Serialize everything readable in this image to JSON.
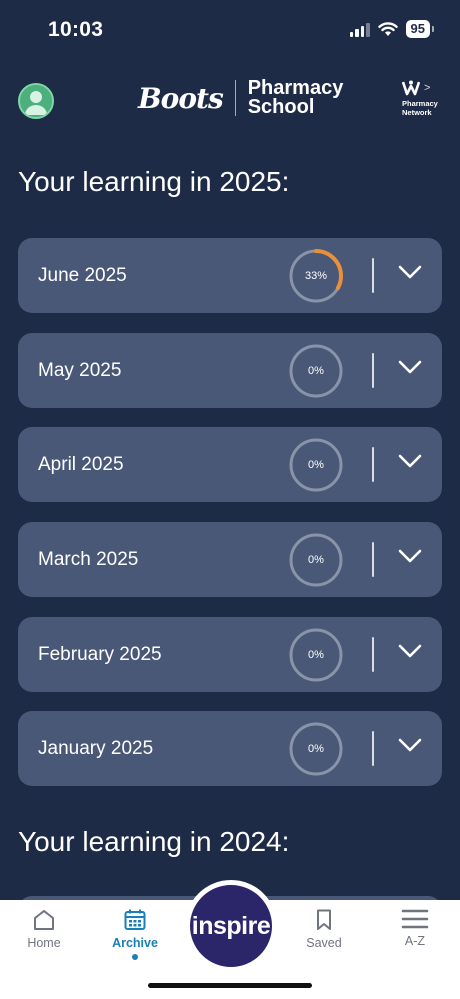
{
  "status_bar": {
    "time": "10:03",
    "battery": "95"
  },
  "header": {
    "brand_name": "Boots",
    "brand_product_line1": "Pharmacy",
    "brand_product_line2": "School",
    "network_label_line1": "Pharmacy",
    "network_label_line2": "Network",
    "network_chevron": ">"
  },
  "sections": [
    {
      "title": "Your learning in 2025:",
      "months": [
        {
          "label": "June 2025",
          "progress_text": "33%",
          "progress": 0.33
        },
        {
          "label": "May 2025",
          "progress_text": "0%",
          "progress": 0
        },
        {
          "label": "April 2025",
          "progress_text": "0%",
          "progress": 0
        },
        {
          "label": "March 2025",
          "progress_text": "0%",
          "progress": 0
        },
        {
          "label": "February 2025",
          "progress_text": "0%",
          "progress": 0
        },
        {
          "label": "January 2025",
          "progress_text": "0%",
          "progress": 0
        }
      ]
    },
    {
      "title": "Your learning in 2024:"
    }
  ],
  "nav": {
    "home": "Home",
    "archive": "Archive",
    "inspire": "inspire",
    "saved": "Saved",
    "az": "A-Z"
  },
  "colors": {
    "background": "#1e2b47",
    "card": "#4a5878",
    "progress_track": "#8a94a8",
    "progress_fill": "#e8913a",
    "nav_active": "#1a7fb5",
    "inspire_bg": "#2a2669"
  },
  "icons": [
    "signal-icon",
    "wifi-icon",
    "battery-icon",
    "avatar-icon",
    "network-logo-icon",
    "chevron-down-icon",
    "home-icon",
    "calendar-icon",
    "bookmark-icon",
    "list-icon"
  ]
}
